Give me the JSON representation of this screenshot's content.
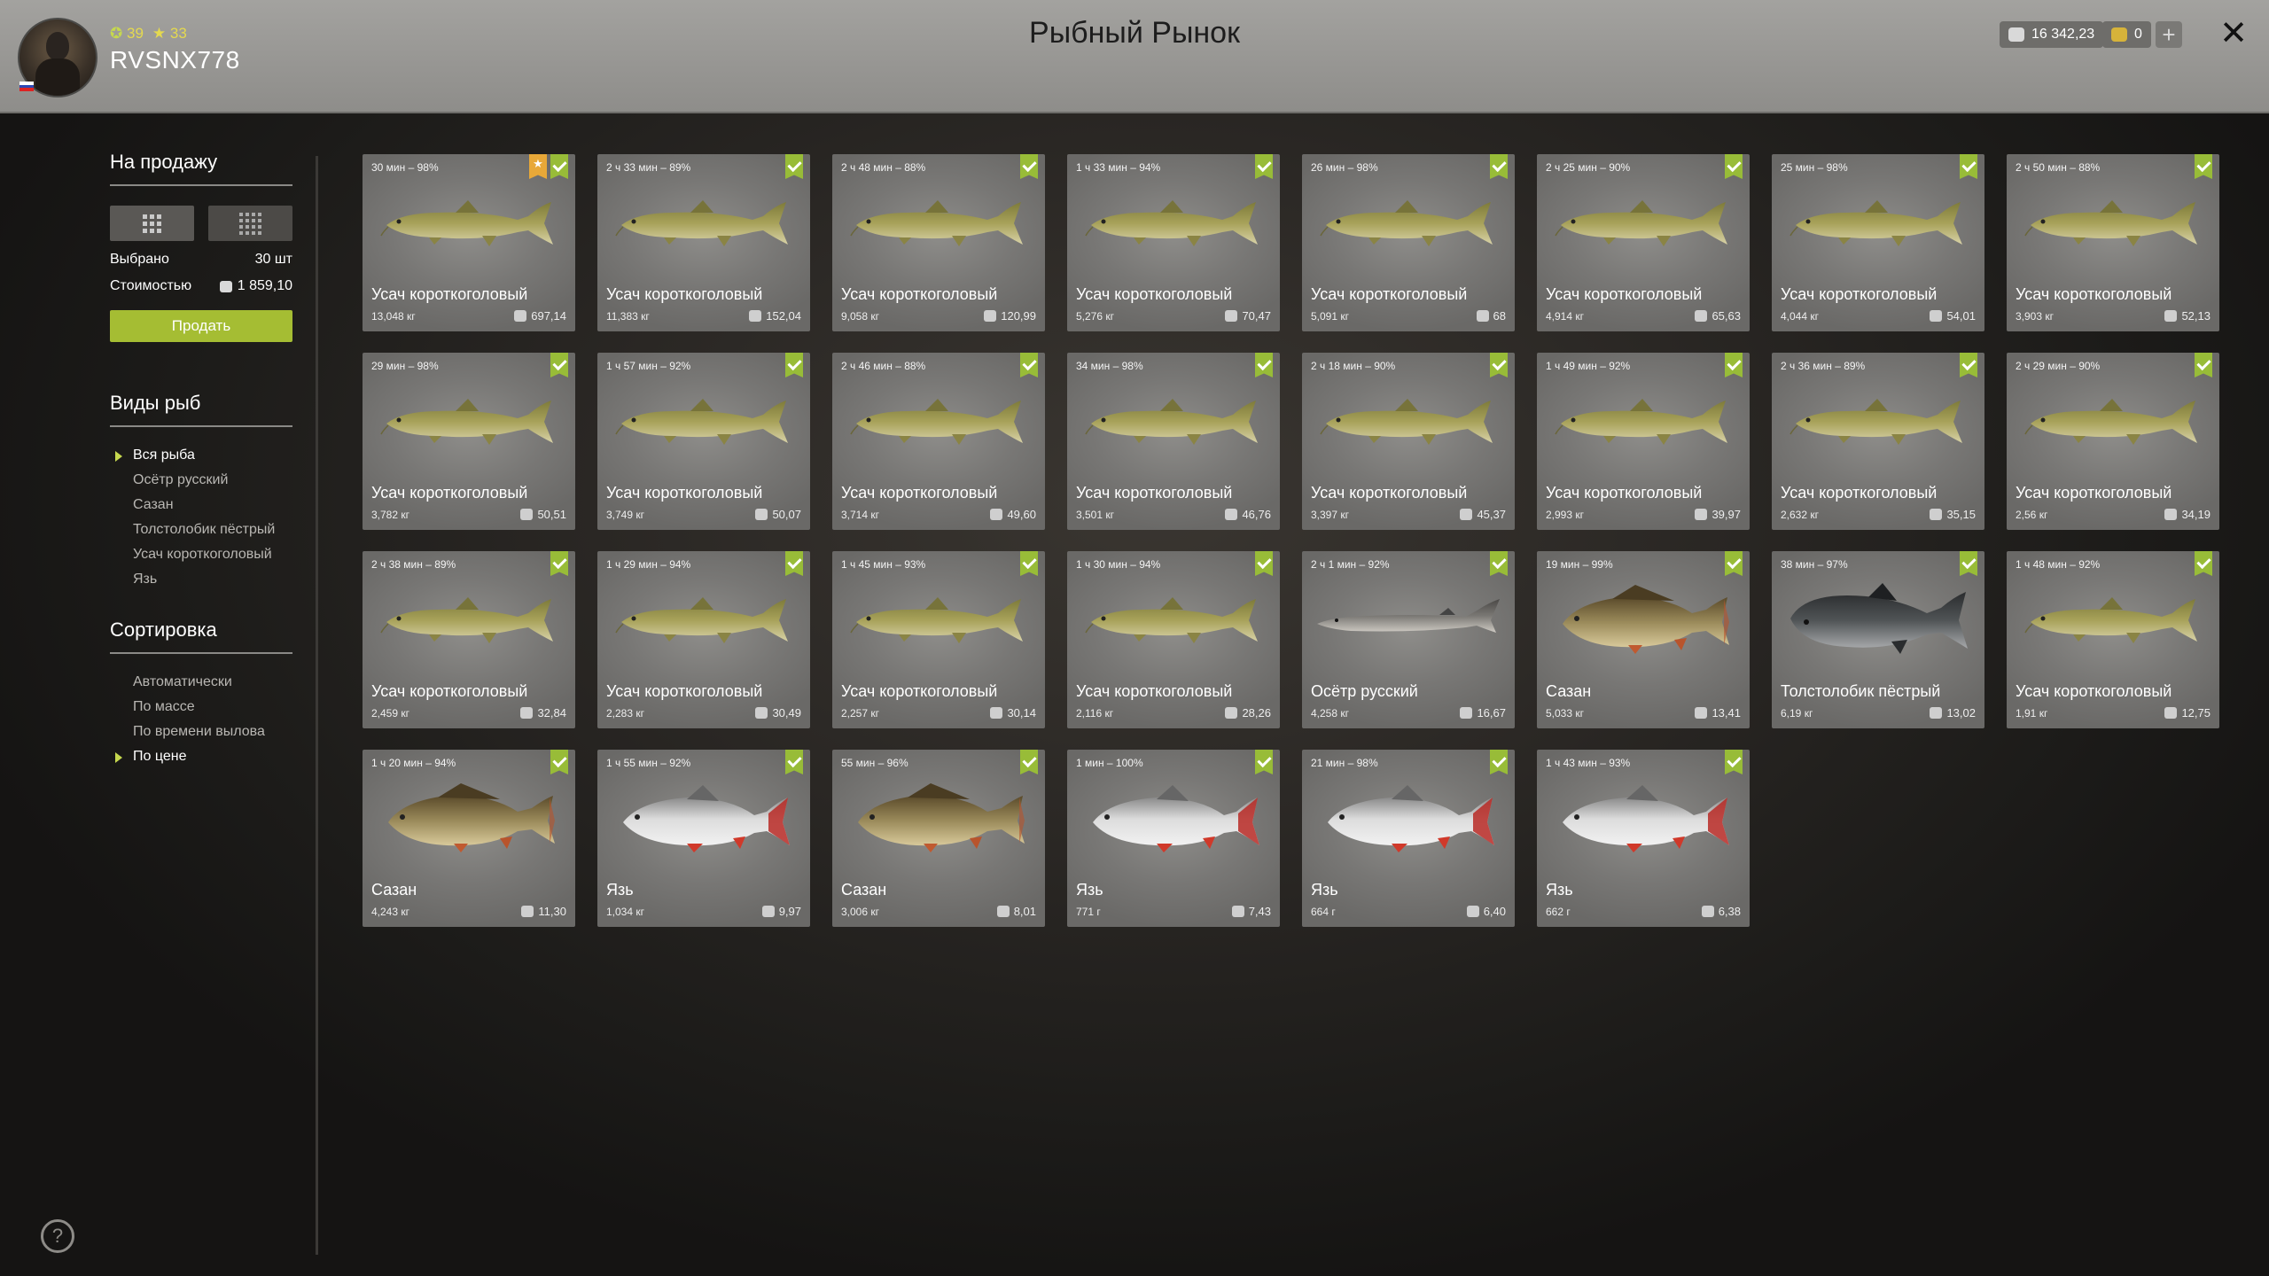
{
  "header": {
    "title": "Рыбный Рынок",
    "username": "RVSNX778",
    "stat1": "39",
    "stat2": "33",
    "silver": "16 342,23",
    "gold": "0",
    "plus": "+",
    "close": "✕"
  },
  "sidebar": {
    "for_sale_title": "На продажу",
    "selected_label": "Выбрано",
    "selected_value": "30 шт",
    "cost_label": "Стоимостью",
    "cost_value": "1 859,10",
    "sell_button": "Продать",
    "species_title": "Виды рыб",
    "species": [
      {
        "label": "Вся рыба",
        "active": true
      },
      {
        "label": "Осётр русский",
        "active": false
      },
      {
        "label": "Сазан",
        "active": false
      },
      {
        "label": "Толстолобик пёстрый",
        "active": false
      },
      {
        "label": "Усач короткоголовый",
        "active": false
      },
      {
        "label": "Язь",
        "active": false
      }
    ],
    "sort_title": "Сортировка",
    "sort": [
      {
        "label": "Автоматически",
        "active": false
      },
      {
        "label": "По массе",
        "active": false
      },
      {
        "label": "По времени вылова",
        "active": false
      },
      {
        "label": "По цене",
        "active": true
      }
    ]
  },
  "help": "?",
  "colors": {
    "accent": "#a5bd33",
    "check": "#98bc38",
    "star": "#e8a838",
    "silver_coin": "#d9d9d9",
    "gold_coin": "#d6b33a"
  },
  "cards": [
    {
      "time": "30 мин – 98%",
      "name": "Усач короткоголовый",
      "weight": "13,048 кг",
      "price": "697,14",
      "fish": "barbel",
      "star": true
    },
    {
      "time": "2 ч 33 мин – 89%",
      "name": "Усач короткоголовый",
      "weight": "11,383 кг",
      "price": "152,04",
      "fish": "barbel"
    },
    {
      "time": "2 ч 48 мин – 88%",
      "name": "Усач короткоголовый",
      "weight": "9,058 кг",
      "price": "120,99",
      "fish": "barbel"
    },
    {
      "time": "1 ч 33 мин – 94%",
      "name": "Усач короткоголовый",
      "weight": "5,276 кг",
      "price": "70,47",
      "fish": "barbel"
    },
    {
      "time": "26 мин – 98%",
      "name": "Усач короткоголовый",
      "weight": "5,091 кг",
      "price": "68",
      "fish": "barbel"
    },
    {
      "time": "2 ч 25 мин – 90%",
      "name": "Усач короткоголовый",
      "weight": "4,914 кг",
      "price": "65,63",
      "fish": "barbel"
    },
    {
      "time": "25 мин – 98%",
      "name": "Усач короткоголовый",
      "weight": "4,044 кг",
      "price": "54,01",
      "fish": "barbel"
    },
    {
      "time": "2 ч 50 мин – 88%",
      "name": "Усач короткоголовый",
      "weight": "3,903 кг",
      "price": "52,13",
      "fish": "barbel"
    },
    {
      "time": "29 мин – 98%",
      "name": "Усач короткоголовый",
      "weight": "3,782 кг",
      "price": "50,51",
      "fish": "barbel"
    },
    {
      "time": "1 ч 57 мин – 92%",
      "name": "Усач короткоголовый",
      "weight": "3,749 кг",
      "price": "50,07",
      "fish": "barbel"
    },
    {
      "time": "2 ч 46 мин – 88%",
      "name": "Усач короткоголовый",
      "weight": "3,714 кг",
      "price": "49,60",
      "fish": "barbel"
    },
    {
      "time": "34 мин – 98%",
      "name": "Усач короткоголовый",
      "weight": "3,501 кг",
      "price": "46,76",
      "fish": "barbel"
    },
    {
      "time": "2 ч 18 мин – 90%",
      "name": "Усач короткоголовый",
      "weight": "3,397 кг",
      "price": "45,37",
      "fish": "barbel"
    },
    {
      "time": "1 ч 49 мин – 92%",
      "name": "Усач короткоголовый",
      "weight": "2,993 кг",
      "price": "39,97",
      "fish": "barbel"
    },
    {
      "time": "2 ч 36 мин – 89%",
      "name": "Усач короткоголовый",
      "weight": "2,632 кг",
      "price": "35,15",
      "fish": "barbel"
    },
    {
      "time": "2 ч 29 мин – 90%",
      "name": "Усач короткоголовый",
      "weight": "2,56 кг",
      "price": "34,19",
      "fish": "barbel"
    },
    {
      "time": "2 ч 38 мин – 89%",
      "name": "Усач короткоголовый",
      "weight": "2,459 кг",
      "price": "32,84",
      "fish": "barbel"
    },
    {
      "time": "1 ч 29 мин – 94%",
      "name": "Усач короткоголовый",
      "weight": "2,283 кг",
      "price": "30,49",
      "fish": "barbel"
    },
    {
      "time": "1 ч 45 мин – 93%",
      "name": "Усач короткоголовый",
      "weight": "2,257 кг",
      "price": "30,14",
      "fish": "barbel"
    },
    {
      "time": "1 ч 30 мин – 94%",
      "name": "Усач короткоголовый",
      "weight": "2,116 кг",
      "price": "28,26",
      "fish": "barbel"
    },
    {
      "time": "2 ч 1 мин – 92%",
      "name": "Осётр русский",
      "weight": "4,258 кг",
      "price": "16,67",
      "fish": "sturgeon"
    },
    {
      "time": "19 мин – 99%",
      "name": "Сазан",
      "weight": "5,033 кг",
      "price": "13,41",
      "fish": "carp"
    },
    {
      "time": "38 мин – 97%",
      "name": "Толстолобик пёстрый",
      "weight": "6,19 кг",
      "price": "13,02",
      "fish": "bighead"
    },
    {
      "time": "1 ч 48 мин – 92%",
      "name": "Усач короткоголовый",
      "weight": "1,91 кг",
      "price": "12,75",
      "fish": "barbel"
    },
    {
      "time": "1 ч 20 мин – 94%",
      "name": "Сазан",
      "weight": "4,243 кг",
      "price": "11,30",
      "fish": "carp"
    },
    {
      "time": "1 ч 55 мин – 92%",
      "name": "Язь",
      "weight": "1,034 кг",
      "price": "9,97",
      "fish": "ide"
    },
    {
      "time": "55 мин – 96%",
      "name": "Сазан",
      "weight": "3,006 кг",
      "price": "8,01",
      "fish": "carp"
    },
    {
      "time": "1 мин – 100%",
      "name": "Язь",
      "weight": "771 г",
      "price": "7,43",
      "fish": "ide"
    },
    {
      "time": "21 мин – 98%",
      "name": "Язь",
      "weight": "664 г",
      "price": "6,40",
      "fish": "ide"
    },
    {
      "time": "1 ч 43 мин – 93%",
      "name": "Язь",
      "weight": "662 г",
      "price": "6,38",
      "fish": "ide"
    }
  ]
}
